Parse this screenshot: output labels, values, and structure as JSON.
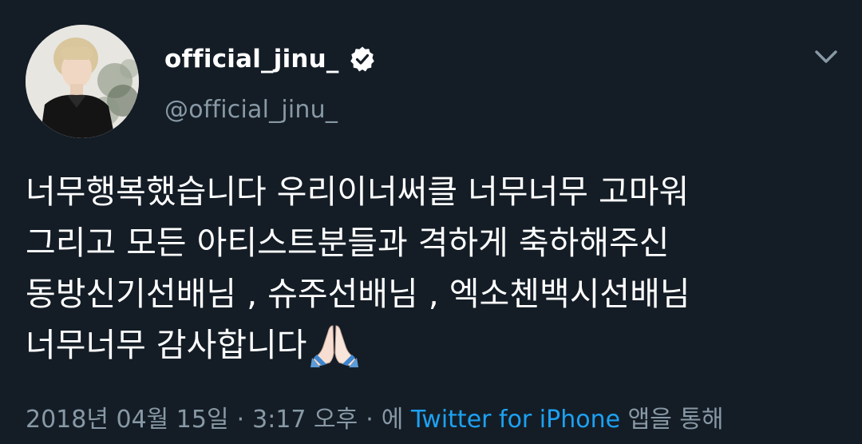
{
  "author": {
    "display_name": "official_jinu_",
    "handle": "@official_jinu_",
    "verified_icon": "verified-badge-icon"
  },
  "tweet": {
    "lines": [
      "너무행복했습니다 우리이너써클 너무너무 고마워",
      "그리고 모든 아티스트분들과 격하게 축하해주신",
      "동방신기선배님 , 슈주선배님 , 엑소첸백시선배님",
      "너무너무 감사합니다"
    ],
    "emoji": "folded-hands-icon"
  },
  "meta": {
    "date": "2018년 04월 15일",
    "separator": "·",
    "time": "3:17 오후",
    "via_prefix": "에",
    "source": "Twitter for iPhone",
    "via_suffix": "앱을 통해"
  },
  "colors": {
    "background": "#141d26",
    "secondary_text": "#8899a6",
    "link": "#1da1f2"
  }
}
